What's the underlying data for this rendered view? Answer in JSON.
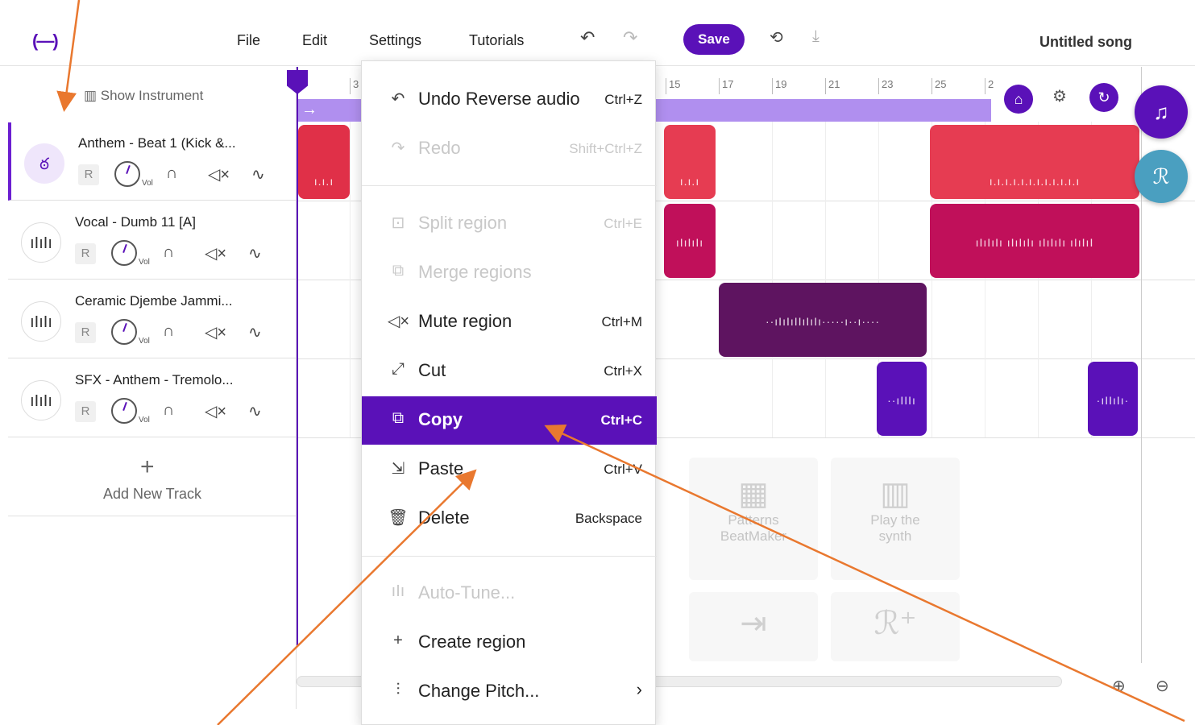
{
  "app": {
    "logo": "(—)",
    "song_title": "Untitled song"
  },
  "menu": {
    "file": "File",
    "edit": "Edit",
    "settings": "Settings",
    "tutorials": "Tutorials",
    "save": "Save"
  },
  "tracklist": {
    "show_instrument": "Show Instrument",
    "r_label": "R",
    "vol_label": "Vol",
    "tracks": [
      {
        "name": "Anthem - Beat 1 (Kick &...",
        "icon": "drum-icon"
      },
      {
        "name": "Vocal - Dumb 11 [A]",
        "icon": "waveform-icon"
      },
      {
        "name": "Ceramic Djembe Jammi...",
        "icon": "waveform-icon"
      },
      {
        "name": "SFX - Anthem - Tremolo...",
        "icon": "waveform-icon"
      }
    ],
    "add_new_track": "Add New Track"
  },
  "ruler": {
    "ticks": [
      "3",
      "15",
      "17",
      "19",
      "21",
      "23",
      "25",
      "2"
    ]
  },
  "cards": {
    "patterns": "Patterns BeatMaker",
    "synth": "Play the synth"
  },
  "context_menu": {
    "items": [
      {
        "label": "Undo Reverse audio",
        "shortcut": "Ctrl+Z",
        "icon": "undo-icon",
        "disabled": false
      },
      {
        "label": "Redo",
        "shortcut": "Shift+Ctrl+Z",
        "icon": "redo-icon",
        "disabled": true
      },
      {
        "label": "Split region",
        "shortcut": "Ctrl+E",
        "icon": "split-icon",
        "disabled": true
      },
      {
        "label": "Merge regions",
        "shortcut": "",
        "icon": "merge-icon",
        "disabled": true
      },
      {
        "label": "Mute region",
        "shortcut": "Ctrl+M",
        "icon": "mute-icon",
        "disabled": false
      },
      {
        "label": "Cut",
        "shortcut": "Ctrl+X",
        "icon": "cut-icon",
        "disabled": false
      },
      {
        "label": "Copy",
        "shortcut": "Ctrl+C",
        "icon": "copy-icon",
        "disabled": false,
        "highlighted": true
      },
      {
        "label": "Paste",
        "shortcut": "Ctrl+V",
        "icon": "paste-icon",
        "disabled": false
      },
      {
        "label": "Delete",
        "shortcut": "Backspace",
        "icon": "delete-icon",
        "disabled": false
      },
      {
        "label": "Auto-Tune...",
        "shortcut": "",
        "icon": "autotune-icon",
        "disabled": true
      },
      {
        "label": "Create region",
        "shortcut": "",
        "icon": "plus-icon",
        "disabled": false
      },
      {
        "label": "Change Pitch...",
        "shortcut": "",
        "icon": "pitch-icon",
        "disabled": false
      }
    ]
  },
  "colors": {
    "accent": "#5a11b8",
    "kick": "#e03048",
    "vocal": "#c0105a",
    "djembe": "#5e1460",
    "annotation": "#e9782f"
  }
}
